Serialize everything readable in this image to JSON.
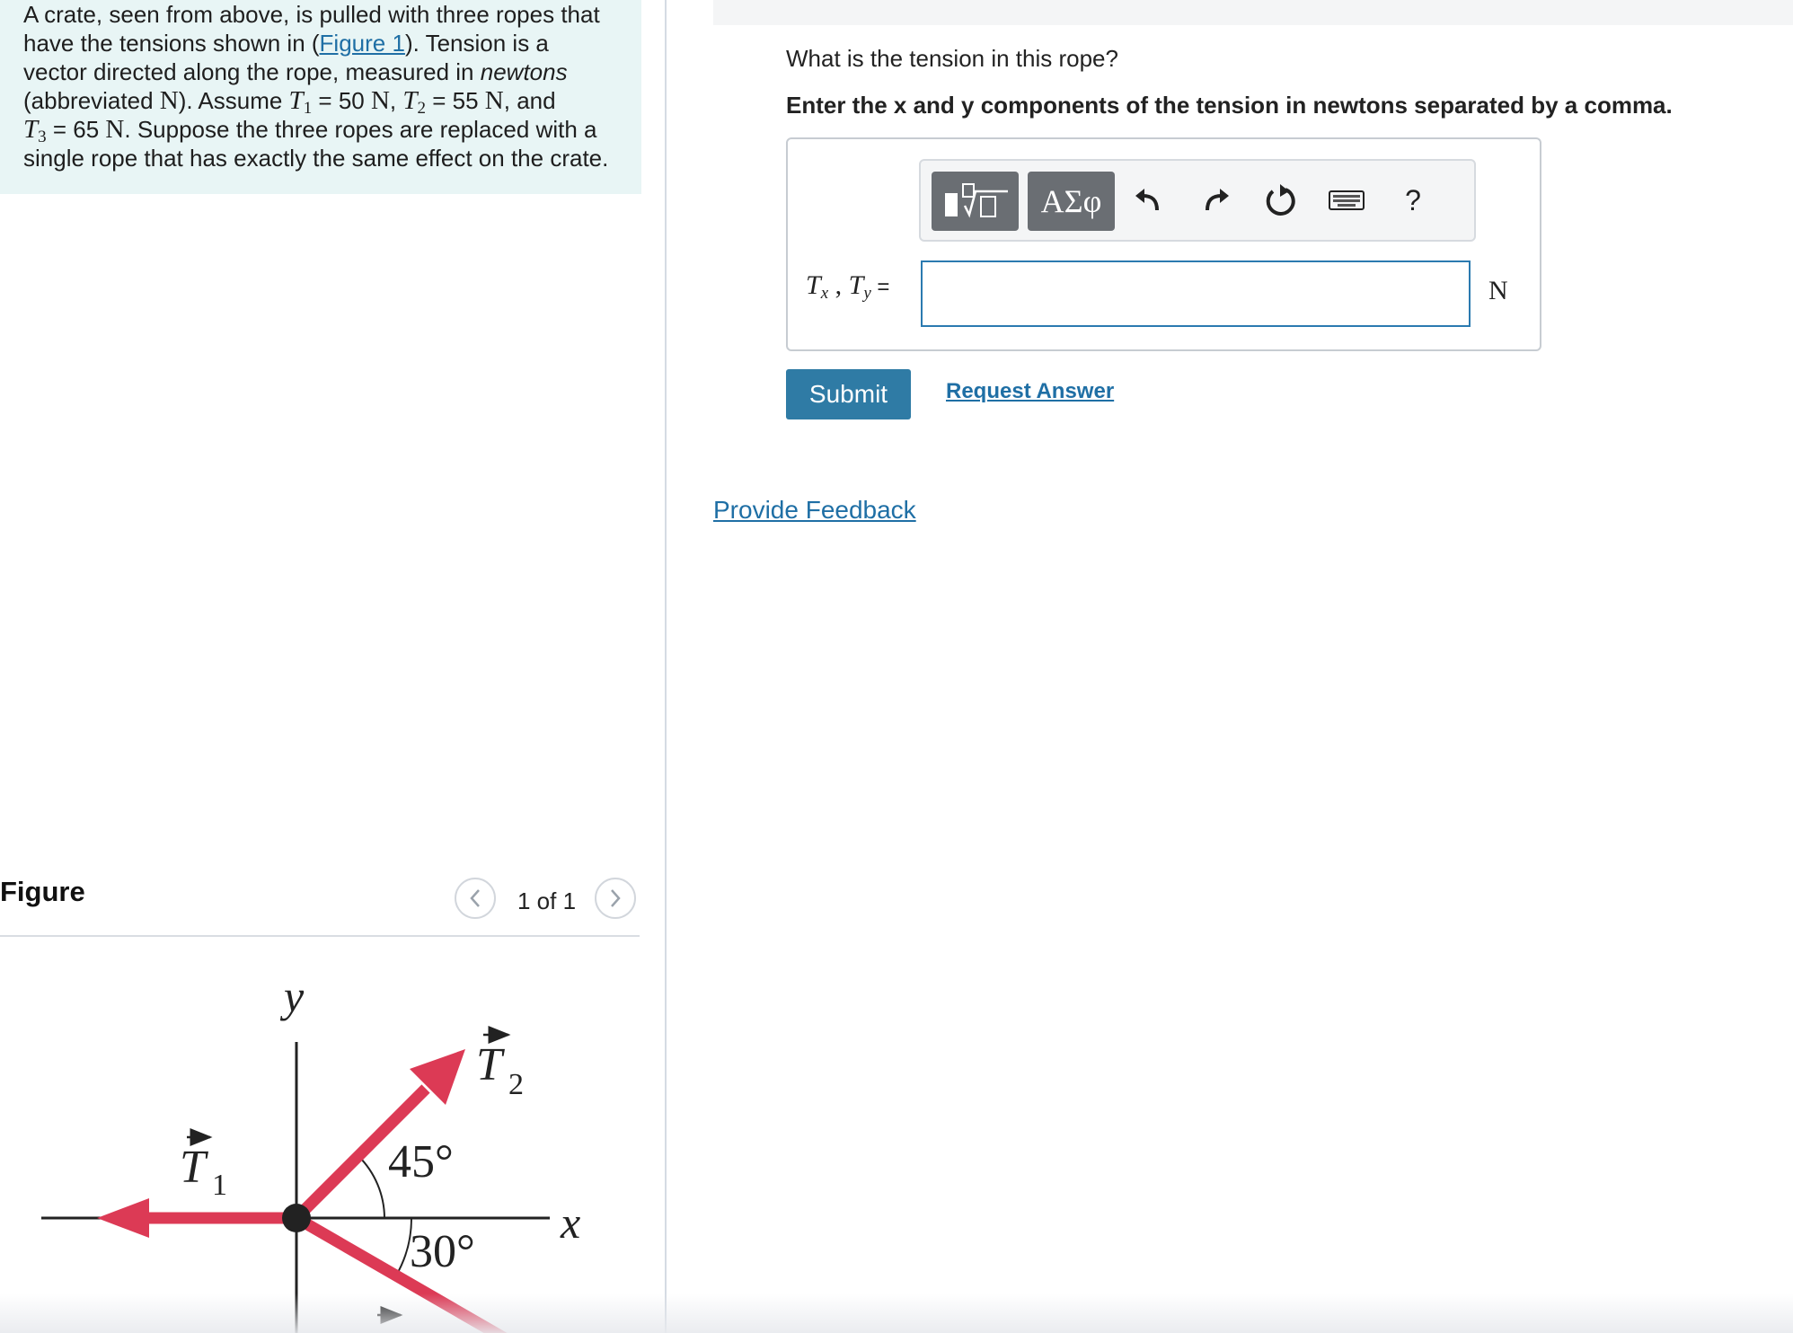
{
  "problem": {
    "line1": "A crate, seen from above, is pulled with three ropes that",
    "line2_pre": "have the tensions shown in (",
    "figure_link": "Figure 1",
    "line2_post": "). Tension is a",
    "line3_pre": "vector directed along the rope, measured in ",
    "line3_em": "newtons",
    "line4_pre": "(abbreviated ",
    "unit_N": "N",
    "line4_mid": "). Assume ",
    "T": "T",
    "sub1": "1",
    "sub2": "2",
    "sub3": "3",
    "t1_value": " = 50 ",
    "comma": ", ",
    "t2_value": " = 55 ",
    "and_text": ", and",
    "t3_value": " = 65 ",
    "line5_post": ". Suppose the three ropes are replaced with a",
    "line6": "single rope that has exactly the same effect on the crate."
  },
  "figure_panel": {
    "title": "Figure",
    "prev_icon": "chevron-left-icon",
    "next_icon": "chevron-right-icon",
    "count": "1 of 1",
    "labels": {
      "y_axis": "y",
      "x_axis": "x",
      "t1": "T",
      "t1_sub": "1",
      "t2": "T",
      "t2_sub": "2",
      "angle45": "45°",
      "angle30": "30°"
    },
    "colors": {
      "arrow": "#dc3a55",
      "axis": "#222222"
    }
  },
  "question": {
    "prompt": "What is the tension in this rope?",
    "instruction": "Enter the x and y components of the tension in newtons separated by a comma."
  },
  "toolbar": {
    "templates_icon": "templates-icon",
    "symbols_label": "ΑΣφ",
    "undo_icon": "undo-icon",
    "redo_icon": "redo-icon",
    "reset_icon": "reset-icon",
    "keyboard_icon": "keyboard-icon",
    "help_label": "?"
  },
  "answer": {
    "label_T": "T",
    "label_x": "x",
    "label_sep": " , ",
    "label_y": "y",
    "label_eq": " =",
    "value": "",
    "unit": "N"
  },
  "actions": {
    "submit": "Submit",
    "request_answer": "Request Answer",
    "provide_feedback": "Provide Feedback"
  },
  "colors": {
    "accent": "#2f7ba5",
    "link": "#1f6fa5",
    "panel_bg": "#e8f5f5",
    "input_border": "#2b7ab0"
  }
}
